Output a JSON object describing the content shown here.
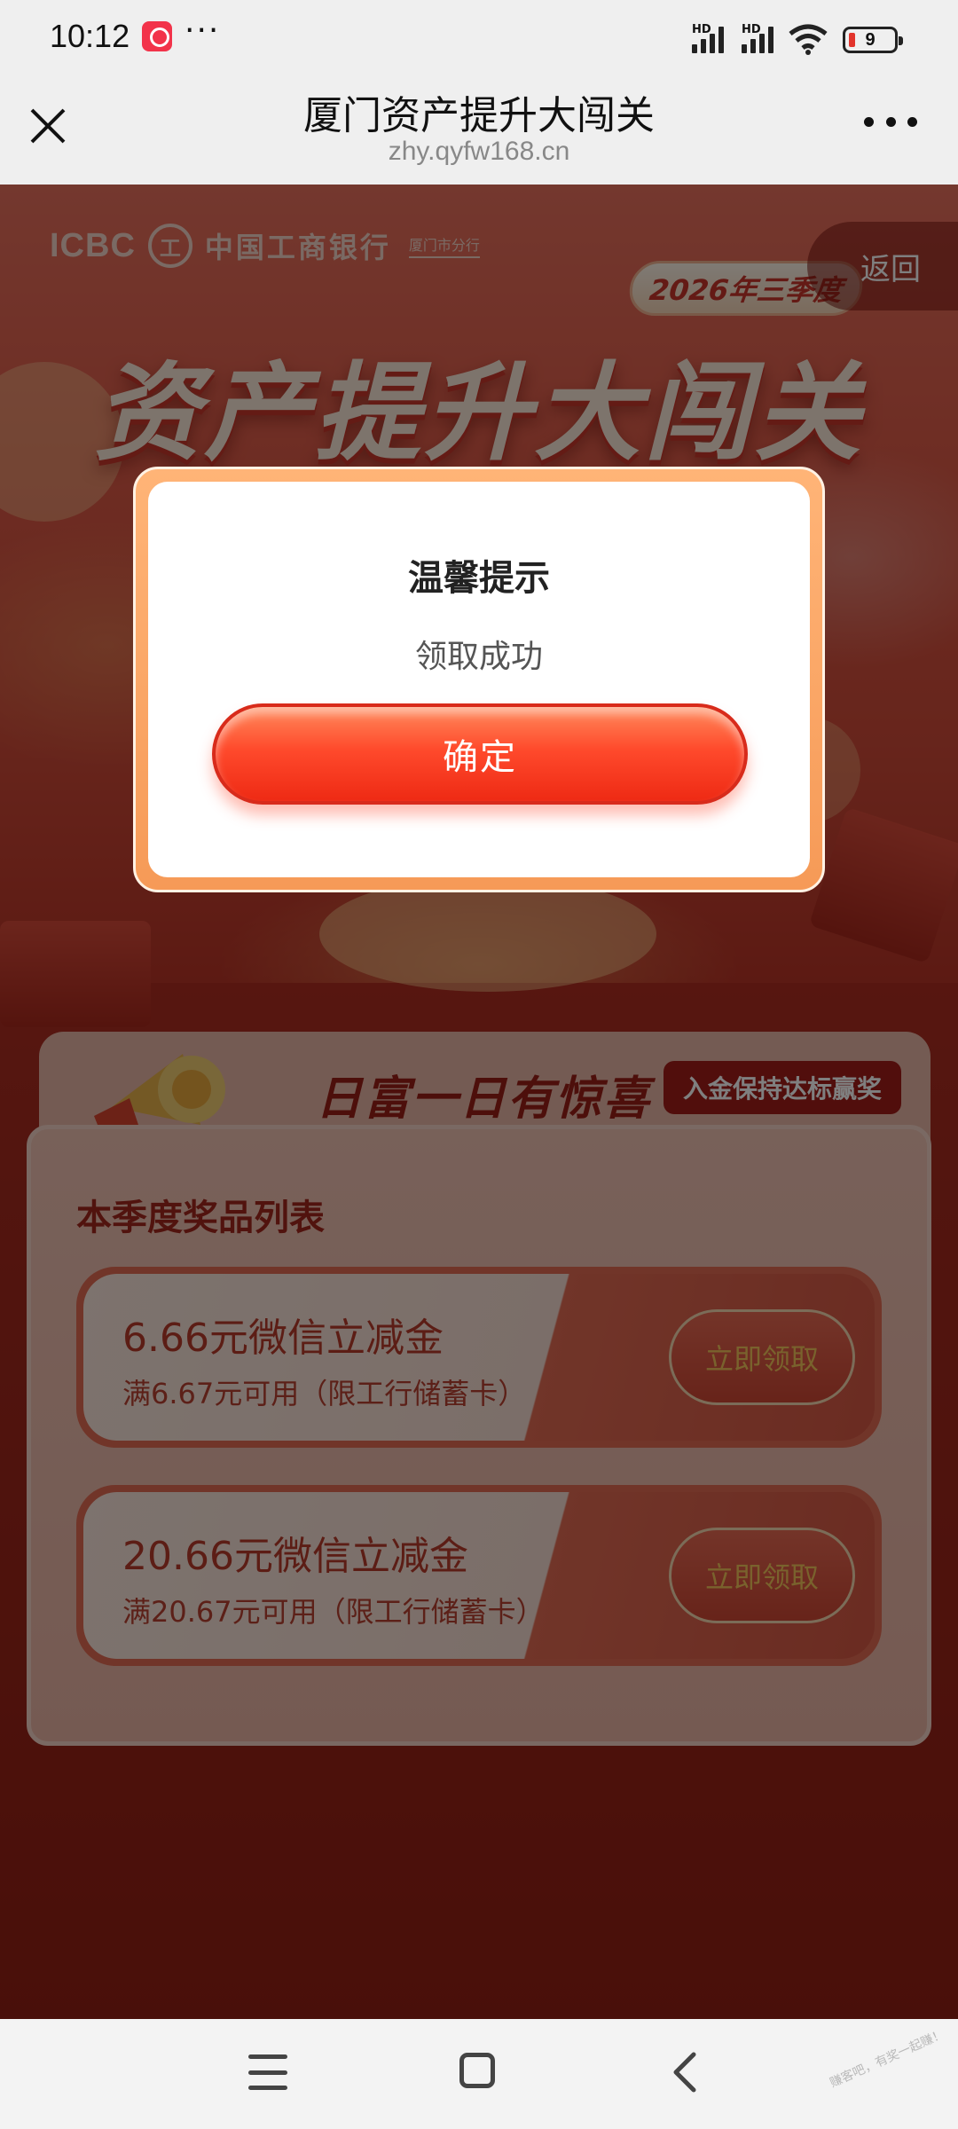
{
  "status_bar": {
    "time": "10:12",
    "dots": "···",
    "battery": "9",
    "hd1": "HD",
    "hd2": "HD"
  },
  "title_bar": {
    "title": "厦门资产提升大闯关",
    "url": "zhy.qyfw168.cn"
  },
  "hero": {
    "bank_name_en": "ICBC",
    "bank_mark": "工",
    "bank_name_cn": "中国工商银行",
    "branch": "厦门市分行",
    "back_label": "返回",
    "season": "2026年三季度",
    "title": "资产提升大闯关"
  },
  "panel": {
    "heading": "日富一日有惊喜",
    "badge": "入金保持达标赢奖",
    "subtitle": "本季度奖品列表",
    "prizes": [
      {
        "name": "6.66元微信立减金",
        "desc": "满6.67元可用（限工行储蓄卡）",
        "button": "立即领取"
      },
      {
        "name": "20.66元微信立减金",
        "desc": "满20.67元可用（限工行储蓄卡）",
        "button": "立即领取"
      }
    ]
  },
  "dialog": {
    "title": "温馨提示",
    "message": "领取成功",
    "confirm": "确定"
  },
  "watermark": "赚客吧，有奖一起赚！"
}
